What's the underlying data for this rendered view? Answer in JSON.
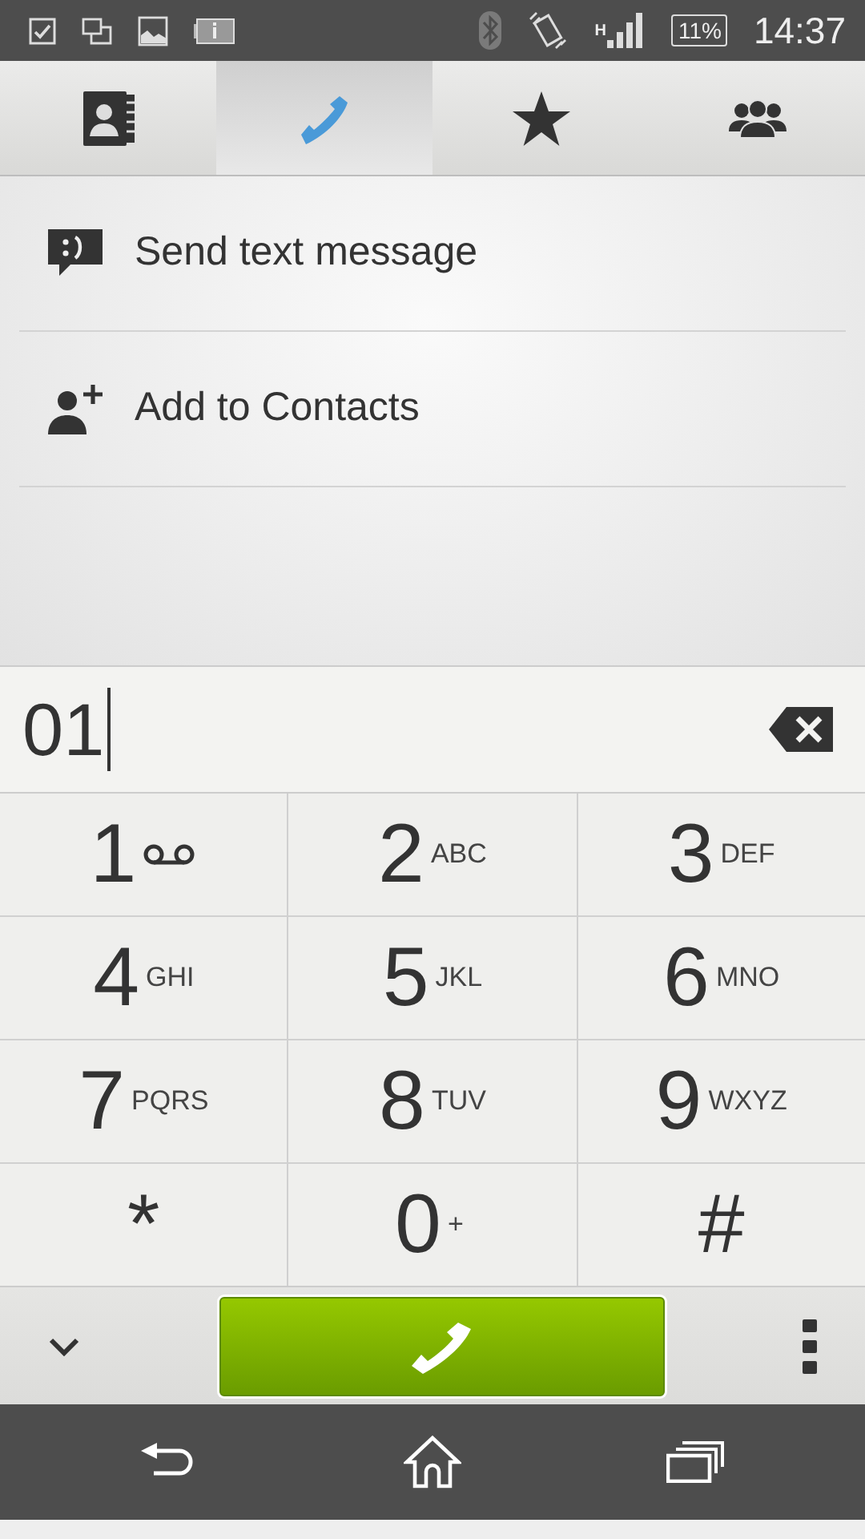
{
  "status_bar": {
    "network": "H",
    "battery": "11%",
    "time": "14:37"
  },
  "tabs": [
    {
      "kind": "contacts",
      "selected": false
    },
    {
      "kind": "phone",
      "selected": true
    },
    {
      "kind": "favorites",
      "selected": false
    },
    {
      "kind": "groups",
      "selected": false
    }
  ],
  "actions": [
    {
      "kind": "message",
      "label": "Send text message"
    },
    {
      "kind": "add-contact",
      "label": "Add to Contacts"
    }
  ],
  "dial_field": {
    "value": "01"
  },
  "keypad": [
    {
      "digit": "1",
      "kind": "voicemail"
    },
    {
      "digit": "2",
      "letters": "ABC",
      "kind": "letters"
    },
    {
      "digit": "3",
      "letters": "DEF",
      "kind": "letters"
    },
    {
      "digit": "4",
      "letters": "GHI",
      "kind": "letters"
    },
    {
      "digit": "5",
      "letters": "JKL",
      "kind": "letters"
    },
    {
      "digit": "6",
      "letters": "MNO",
      "kind": "letters"
    },
    {
      "digit": "7",
      "letters": "PQRS",
      "kind": "letters"
    },
    {
      "digit": "8",
      "letters": "TUV",
      "kind": "letters"
    },
    {
      "digit": "9",
      "letters": "WXYZ",
      "kind": "letters"
    },
    {
      "digit": "*",
      "kind": "plain"
    },
    {
      "digit": "0",
      "letters": "+",
      "kind": "letters"
    },
    {
      "digit": "#",
      "kind": "plain"
    }
  ]
}
